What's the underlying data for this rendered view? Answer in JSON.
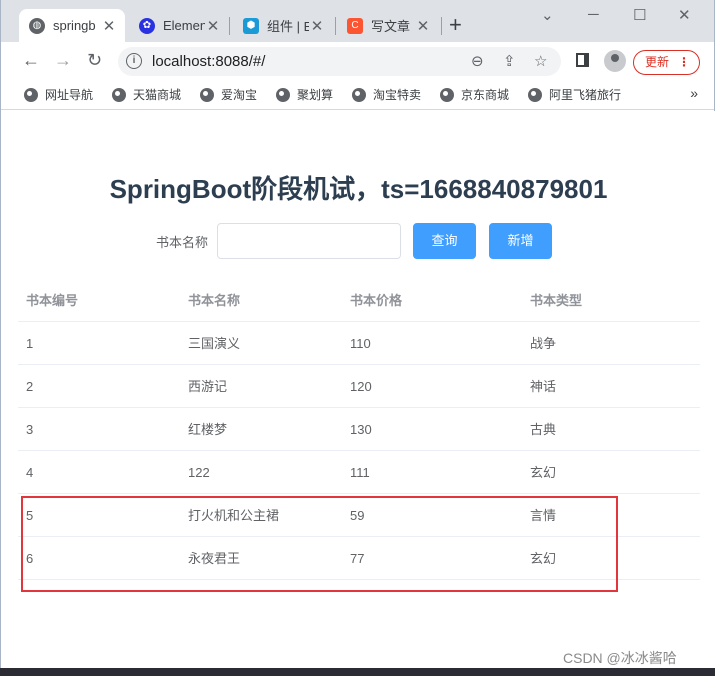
{
  "browser": {
    "tabs": [
      {
        "title": "springb",
        "favicon": "globe-icon",
        "active": true
      },
      {
        "title": "Elemen",
        "favicon": "paw-icon",
        "active": false
      },
      {
        "title": "组件 | E",
        "favicon": "hexagon-icon",
        "active": false
      },
      {
        "title": "写文章",
        "favicon": "csdn-c-icon",
        "active": false
      }
    ],
    "url": "localhost:8088/#/",
    "update_label": "更新",
    "bookmarks": [
      "网址导航",
      "天猫商城",
      "爱淘宝",
      "聚划算",
      "淘宝特卖",
      "京东商城",
      "阿里飞猪旅行"
    ]
  },
  "page": {
    "heading": "SpringBoot阶段机试，ts=1668840879801",
    "search": {
      "label": "书本名称",
      "value": "",
      "placeholder": ""
    },
    "query_button": "查询",
    "add_button": "新增",
    "table": {
      "columns": [
        "书本编号",
        "书本名称",
        "书本价格",
        "书本类型"
      ],
      "rows": [
        [
          "1",
          "三国演义",
          "110",
          "战争"
        ],
        [
          "2",
          "西游记",
          "120",
          "神话"
        ],
        [
          "3",
          "红楼梦",
          "130",
          "古典"
        ],
        [
          "4",
          "122",
          "111",
          "玄幻"
        ],
        [
          "5",
          "打火机和公主裙",
          "59",
          "言情"
        ],
        [
          "6",
          "永夜君王",
          "77",
          "玄幻"
        ]
      ]
    }
  },
  "watermark": "CSDN @冰冰酱哈",
  "colors": {
    "primary": "#409eff",
    "highlight": "#e0363c",
    "heading": "#2c3e50"
  }
}
